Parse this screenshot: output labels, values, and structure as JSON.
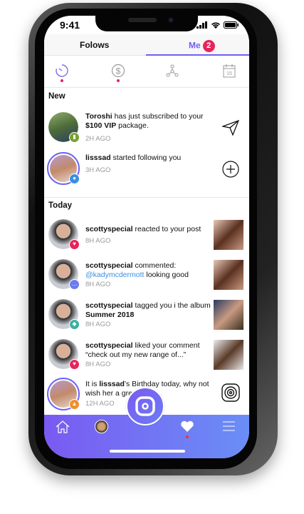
{
  "status_bar": {
    "time": "9:41"
  },
  "tabs": [
    {
      "label": "Folows"
    },
    {
      "label": "Me",
      "badge": "2"
    }
  ],
  "filter_icons": [
    "activity-icon",
    "dollar-icon",
    "network-icon",
    "calendar-icon"
  ],
  "calendar_day": "15",
  "sections": {
    "new": "New",
    "today": "Today"
  },
  "new_items": [
    {
      "user": "Toroshi",
      "text_a": " has just subscribed to your ",
      "bold2": "$100 VIP",
      "text_b": " package.",
      "time": "2H AGO"
    },
    {
      "user": "lisssad",
      "text": " started following you",
      "time": "3H AGO"
    }
  ],
  "today_items": [
    {
      "user": "scottyspecial",
      "text": " reacted to your post",
      "time": "8H AGO"
    },
    {
      "user": "scottyspecial",
      "text": " commented:",
      "mention": "@kadymcdermott",
      "text2": " looking good",
      "time": "8H AGO"
    },
    {
      "user": "scottyspecial",
      "text": " tagged you i the album ",
      "bold2": "Summer 2018",
      "time": "8H AGO"
    },
    {
      "user": "scottyspecial",
      "text": " liked your comment “check out my new range of...”",
      "time": "8H AGO"
    },
    {
      "pre": "It is ",
      "user": "lisssad",
      "text": "’s Birthday today, why not wish her a great day!",
      "time": "12H AGO"
    }
  ],
  "colors": {
    "accent": "#7060f0",
    "badge": "#e8245a",
    "nav_start": "#7a5af2",
    "nav_end": "#6a8ef6"
  }
}
